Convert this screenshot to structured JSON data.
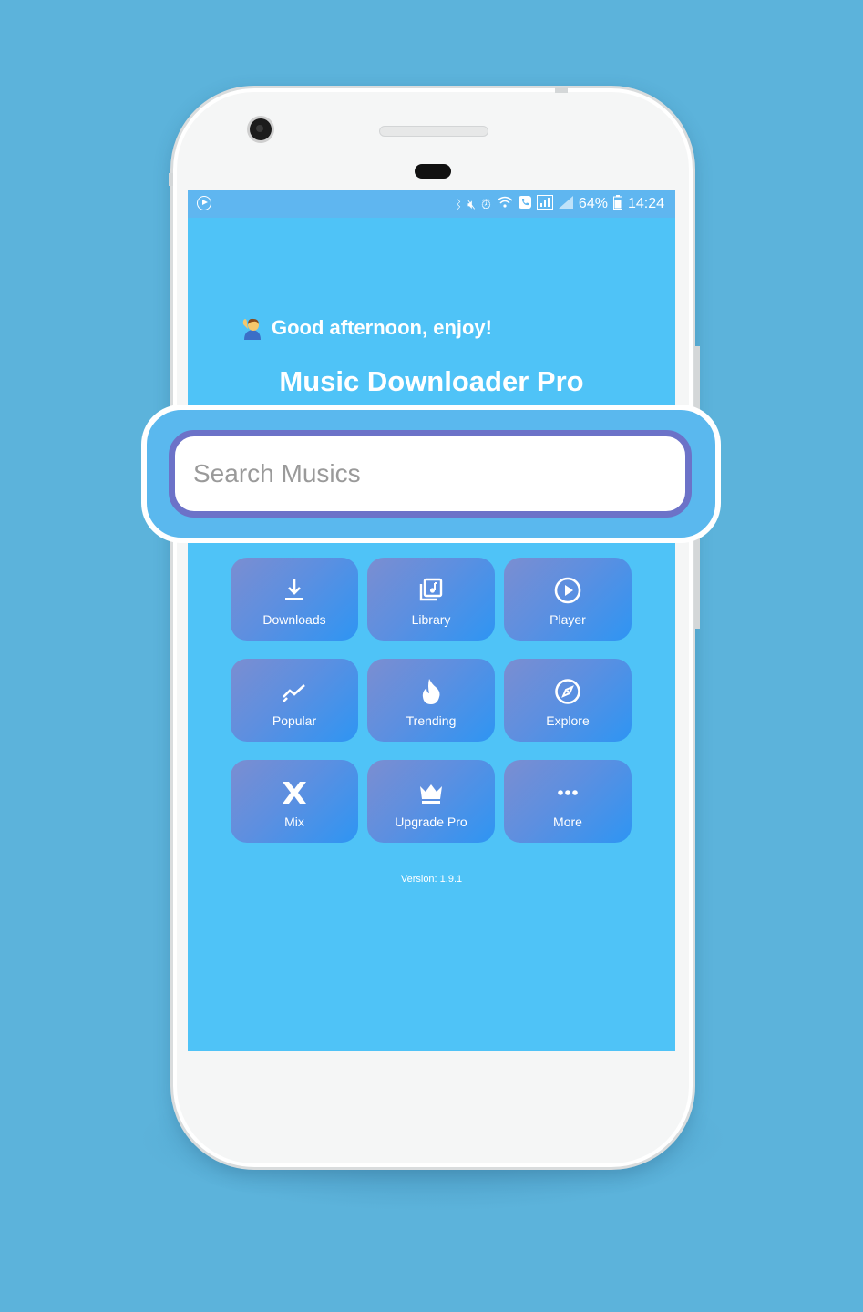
{
  "status_bar": {
    "battery": "64%",
    "time": "14:24"
  },
  "greeting": "Good afternoon, enjoy!",
  "app_title": "Music Downloader Pro",
  "search": {
    "placeholder": "Search Musics"
  },
  "menu": [
    {
      "label": "Downloads",
      "icon": "download-icon"
    },
    {
      "label": "Library",
      "icon": "library-icon"
    },
    {
      "label": "Player",
      "icon": "play-circle-icon"
    },
    {
      "label": "Popular",
      "icon": "trending-line-icon"
    },
    {
      "label": "Trending",
      "icon": "flame-icon"
    },
    {
      "label": "Explore",
      "icon": "compass-icon"
    },
    {
      "label": "Mix",
      "icon": "mix-icon"
    },
    {
      "label": "Upgrade Pro",
      "icon": "crown-icon"
    },
    {
      "label": "More",
      "icon": "more-icon"
    }
  ],
  "version": "Version: 1.9.1",
  "colors": {
    "background": "#5cb3db",
    "screen": "#4fc3f7",
    "search_border": "#6c72c8",
    "tile_start": "#7b8ed1",
    "tile_end": "#2e95f3"
  }
}
